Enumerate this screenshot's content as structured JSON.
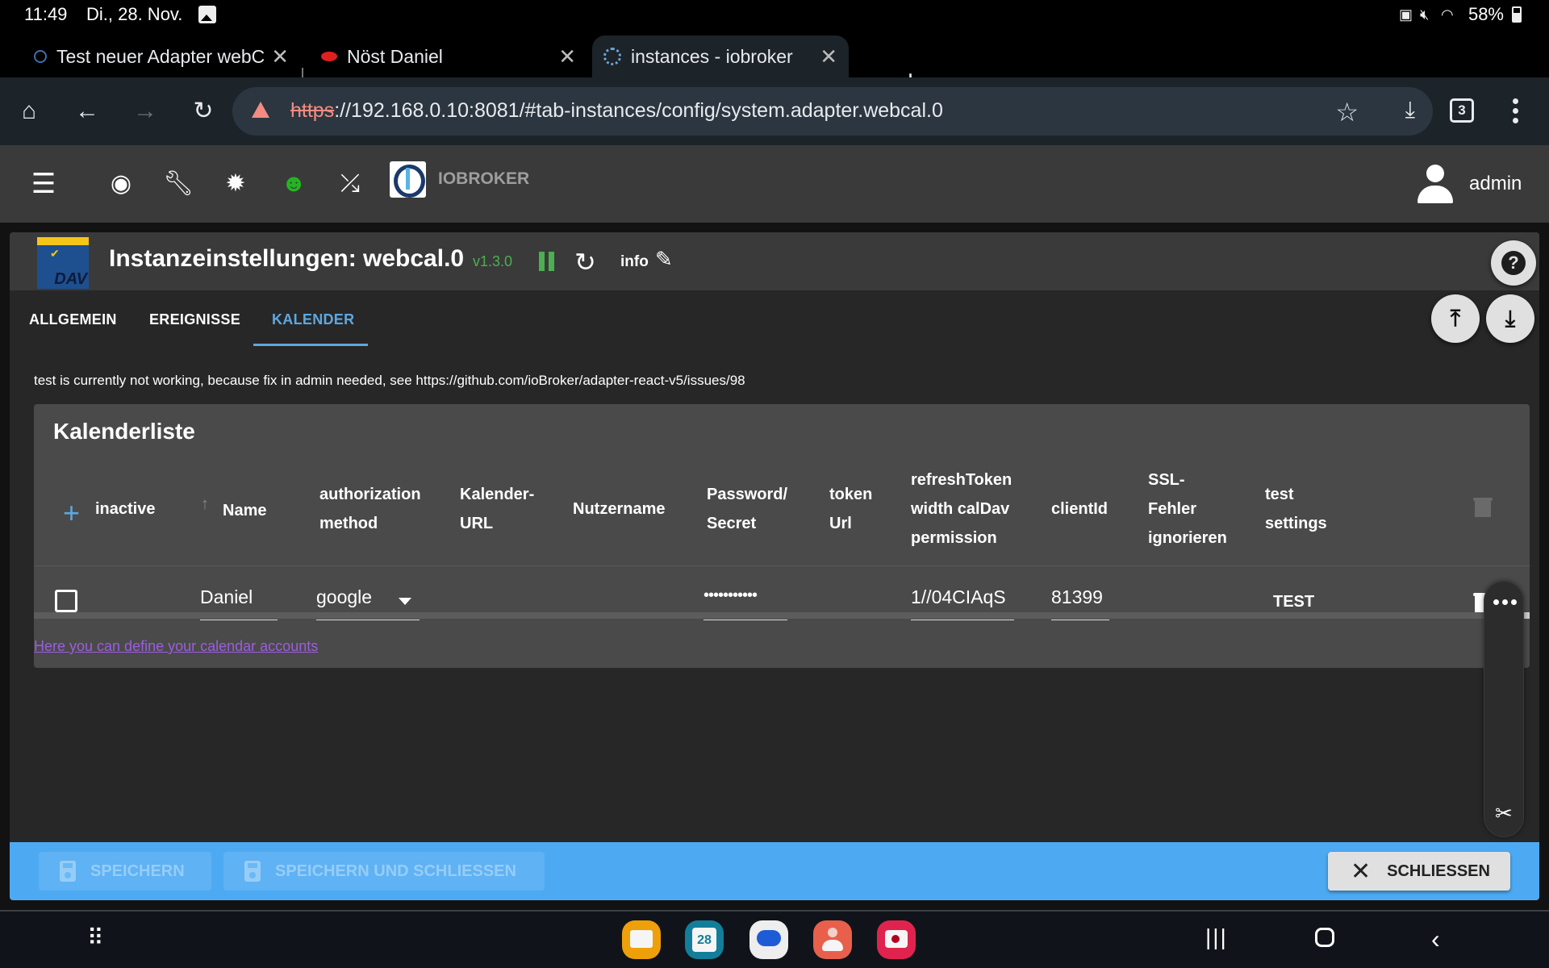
{
  "status_bar": {
    "time": "11:49",
    "date": "Di., 28. Nov.",
    "battery_percent": "58%",
    "icons": [
      "gallery-icon",
      "battery-saver-icon",
      "mute-icon",
      "wifi-icon",
      "battery-icon"
    ]
  },
  "browser": {
    "tabs": [
      {
        "title": "Test neuer Adapter webC",
        "active": false,
        "favicon": "iobroker-icon"
      },
      {
        "title": "Nöst Daniel",
        "active": false,
        "favicon": "red-f-icon"
      },
      {
        "title": "instances - iobroker",
        "active": true,
        "favicon": "iobroker-gear-icon"
      }
    ],
    "new_tab": "+",
    "url_scheme": "https",
    "url_rest": "://192.168.0.10:8081/#tab-instances/config/system.adapter.webcal.0",
    "tab_count": "3"
  },
  "app_header": {
    "brand": "IOBROKER",
    "user": "admin",
    "toolbar_icons": [
      "menu-icon",
      "eye-icon",
      "wrench-icon",
      "theme-icon",
      "expert-mode-icon",
      "sync-disabled-icon"
    ]
  },
  "instance": {
    "title": "Instanzeinstellungen: webcal.0",
    "version": "v1.3.0",
    "info_label": "info",
    "adapter_logo_text": "DAV",
    "status_color": "#4caf50"
  },
  "tabs": [
    {
      "label": "ALLGEMEIN",
      "active": false
    },
    {
      "label": "EREIGNISSE",
      "active": false
    },
    {
      "label": "KALENDER",
      "active": true
    }
  ],
  "notice": "test is currently not working, because fix in admin needed, see https://github.com/ioBroker/adapter-react-v5/issues/98",
  "calendar_table": {
    "title": "Kalenderliste",
    "columns": [
      [
        "inactive"
      ],
      [
        "Name"
      ],
      [
        "authorization",
        "method"
      ],
      [
        "Kalender-",
        "URL"
      ],
      [
        "Nutzername"
      ],
      [
        "Password/",
        "Secret"
      ],
      [
        "token",
        "Url"
      ],
      [
        "refreshToken",
        "width calDav",
        "permission"
      ],
      [
        "clientId"
      ],
      [
        "SSL-",
        "Fehler",
        "ignorieren"
      ],
      [
        "test",
        "settings"
      ]
    ],
    "rows": [
      {
        "inactive": false,
        "name": "Daniel",
        "authorization_method": "google",
        "calendar_url": "",
        "username": "",
        "password": "•••••••••••",
        "token_url": "",
        "refresh_token": "1//04CIAqS",
        "client_id": "81399",
        "ssl_ignore": "",
        "test_label": "TEST"
      }
    ],
    "help_link": "Here you can define your calendar accounts"
  },
  "actions": {
    "save": "SPEICHERN",
    "save_close": "SPEICHERN UND SCHLIESSEN",
    "close": "SCHLIESSEN"
  },
  "colors": {
    "accent": "#5ea7e0",
    "action_bar": "#4daaf2",
    "link": "#9c5de0"
  },
  "dock": {
    "apps": [
      "my-files-icon",
      "calendar-icon",
      "messages-icon",
      "contacts-icon",
      "camera-icon"
    ],
    "calendar_day": "28"
  }
}
